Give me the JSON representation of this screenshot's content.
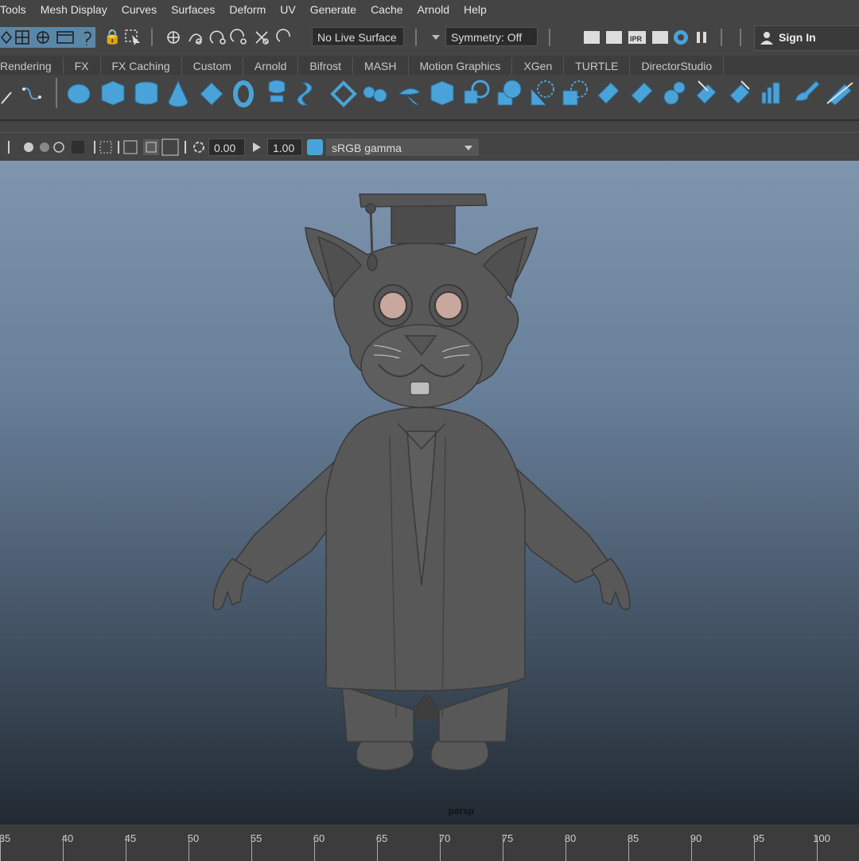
{
  "menu": [
    "Tools",
    "Mesh Display",
    "Curves",
    "Surfaces",
    "Deform",
    "UV",
    "Generate",
    "Cache",
    "Arnold",
    "Help"
  ],
  "status": {
    "live_surface": "No Live Surface",
    "symmetry": "Symmetry: Off",
    "sign_in": "Sign In"
  },
  "shelf_tabs": [
    "Rendering",
    "FX",
    "FX Caching",
    "Custom",
    "Arnold",
    "Bifrost",
    "MASH",
    "Motion Graphics",
    "XGen",
    "TURTLE",
    "DirectorStudio"
  ],
  "panel": {
    "exposure": "0.00",
    "gamma": "1.00",
    "color_space": "sRGB gamma",
    "render_ipr": "IPR"
  },
  "viewport": {
    "camera": "persp"
  },
  "timeline": {
    "ticks": [
      "35",
      "40",
      "45",
      "50",
      "55",
      "60",
      "65",
      "70",
      "75",
      "80",
      "85",
      "90",
      "95",
      "100"
    ]
  },
  "colors": {
    "accent": "#4aa3d8",
    "ui_bg": "#444444",
    "viewport_top": "#7f95ae",
    "viewport_bottom": "#222a33"
  }
}
